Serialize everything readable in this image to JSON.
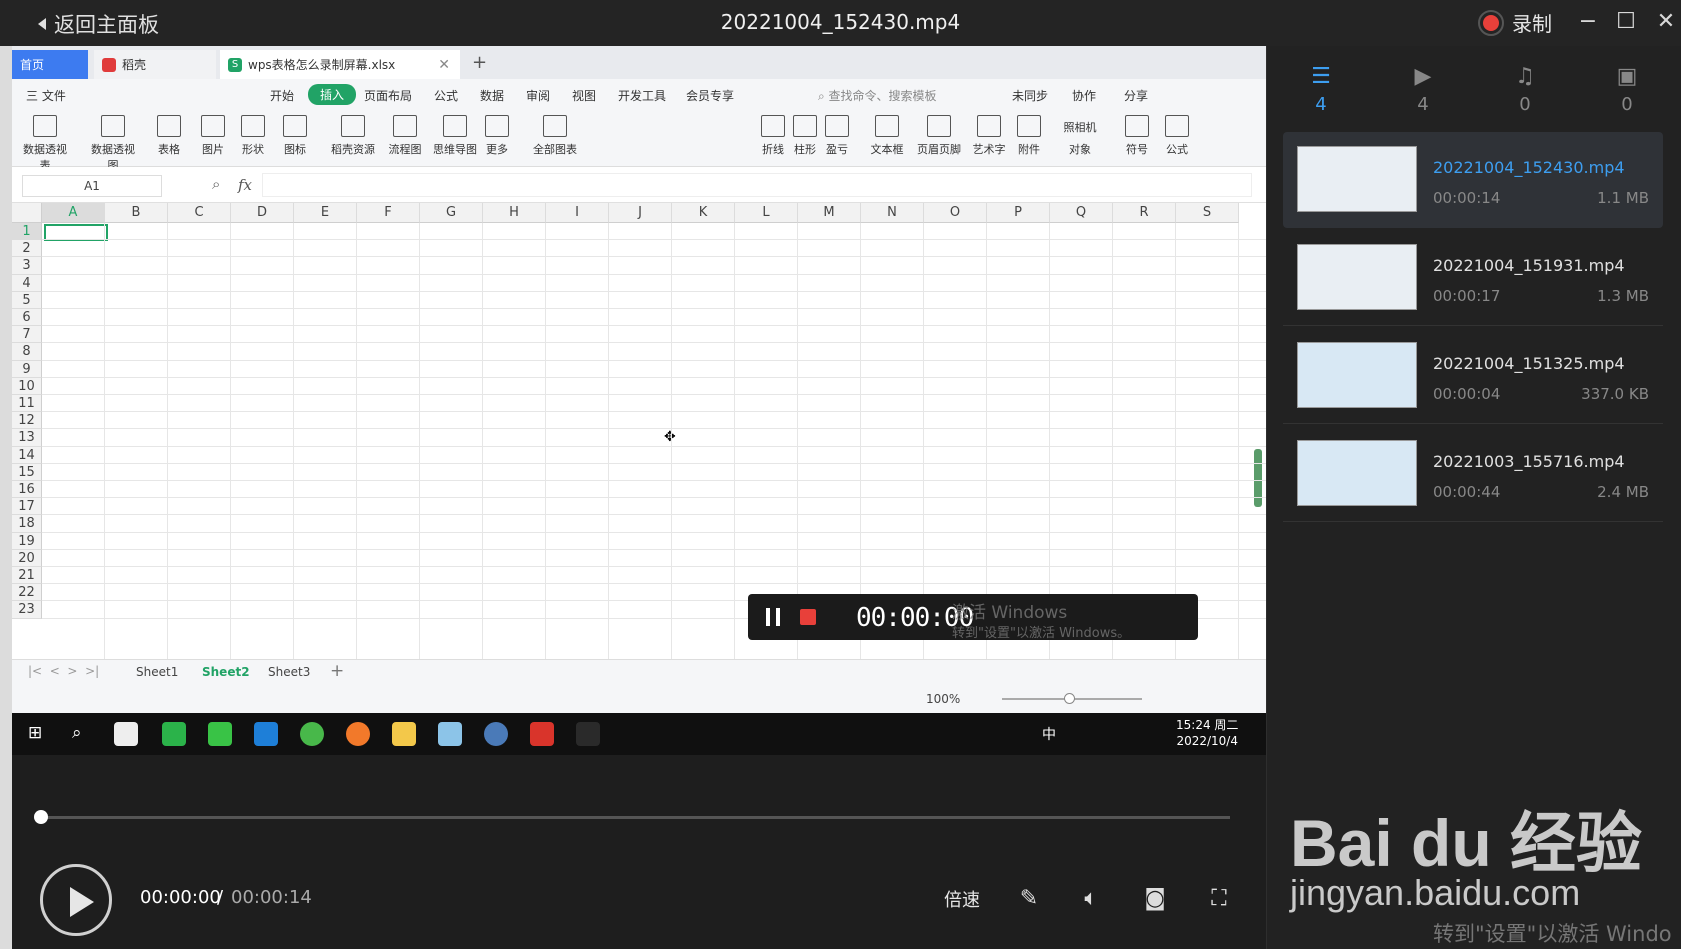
{
  "titlebar": {
    "back_label": "返回主面板",
    "title": "20221004_152430.mp4",
    "record_label": "录制",
    "minimize": "−",
    "maximize": "☐",
    "close": "✕"
  },
  "wps": {
    "tabs": [
      "首页",
      "稻壳",
      "wps表格怎么录制屏幕.xlsx"
    ],
    "menu": [
      "三 文件",
      "开始",
      "插入",
      "页面布局",
      "公式",
      "数据",
      "审阅",
      "视图",
      "开发工具",
      "会员专享"
    ],
    "menu_active": "插入",
    "search_placeholder": "查找命令、搜索模板",
    "menu_right": [
      "未同步",
      "协作",
      "分享"
    ],
    "ribbon": [
      "数据透视表",
      "数据透视图",
      "表格",
      "图片",
      "形状",
      "图标",
      "稻壳资源",
      "流程图",
      "思维导图",
      "更多",
      "全部图表",
      "折线",
      "柱形",
      "盈亏",
      "文本框",
      "页眉页脚",
      "艺术字",
      "附件",
      "对象",
      "符号",
      "公式"
    ],
    "ribbon_extra": "照相机",
    "name_box": "A1",
    "fx": "fx",
    "columns": [
      "A",
      "B",
      "C",
      "D",
      "E",
      "F",
      "G",
      "H",
      "I",
      "J",
      "K",
      "L",
      "M",
      "N",
      "O",
      "P",
      "Q",
      "R",
      "S"
    ],
    "rows": [
      "1",
      "2",
      "3",
      "4",
      "5",
      "6",
      "7",
      "8",
      "9",
      "10",
      "11",
      "12",
      "13",
      "14",
      "15",
      "16",
      "17",
      "18",
      "19",
      "20",
      "21",
      "22",
      "23"
    ],
    "sheets": [
      "Sheet1",
      "Sheet2",
      "Sheet3"
    ],
    "active_sheet": "Sheet2",
    "zoom": "100%",
    "rec_time": "00:00:00",
    "activate_title": "激活 Windows",
    "activate_sub": "转到\"设置\"以激活 Windows。",
    "clock_time": "15:24 周二",
    "clock_date": "2022/10/4",
    "tray_lang": "中"
  },
  "player": {
    "current_time": "00:00:00",
    "separator": "/",
    "total_time": "00:00:14",
    "speed_label": "倍速",
    "progress": 0
  },
  "panel": {
    "tabs": [
      {
        "icon": "list-icon",
        "count": "4"
      },
      {
        "icon": "video-icon",
        "count": "4"
      },
      {
        "icon": "music-icon",
        "count": "0"
      },
      {
        "icon": "image-icon",
        "count": "0"
      }
    ],
    "files": [
      {
        "name": "20221004_152430.mp4",
        "duration": "00:00:14",
        "size": "1.1 MB"
      },
      {
        "name": "20221004_151931.mp4",
        "duration": "00:00:17",
        "size": "1.3 MB"
      },
      {
        "name": "20221004_151325.mp4",
        "duration": "00:00:04",
        "size": "337.0 KB"
      },
      {
        "name": "20221003_155716.mp4",
        "duration": "00:00:44",
        "size": "2.4 MB"
      }
    ]
  },
  "watermark": {
    "brand": "Bai du 经验",
    "url": "jingyan.baidu.com",
    "activate_sub": "转到\"设置\"以激活 Windo"
  },
  "colors": {
    "accent_blue": "#3d9ef0",
    "wps_green": "#21a366",
    "record_red": "#e8403a"
  }
}
